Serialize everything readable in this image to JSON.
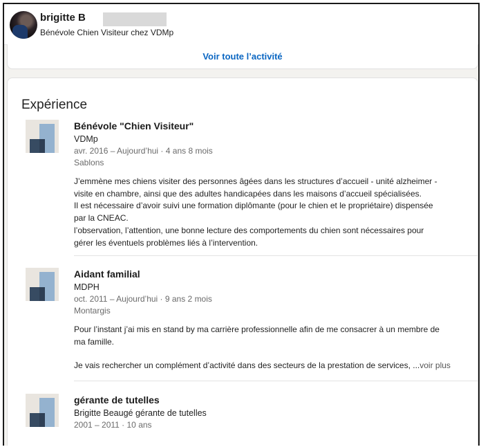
{
  "profile": {
    "name": "brigitte B",
    "headline": "Bénévole Chien Visiteur chez VDMp"
  },
  "activity": {
    "link_label": "Voir toute l’activité"
  },
  "experience": {
    "title": "Expérience",
    "items": [
      {
        "role": "Bénévole \"Chien Visiteur\"",
        "company": "VDMp",
        "dates": "avr. 2016 – Aujourd’hui · 4 ans 8 mois",
        "location": "Sablons",
        "description": [
          "J’emmène mes chiens visiter des personnes âgées dans les structures d’accueil - unité alzheimer -",
          "visite en chambre, ainsi que des adultes handicapées dans les maisons d’accueil spécialisées.",
          "Il est nécessaire d’avoir suivi une formation diplômante (pour le chien et le propriétaire) dispensée",
          "par la CNEAC.",
          "l’observation, l’attention, une bonne lecture des comportements du chien sont nécessaires pour",
          "gérer les éventuels problèmes liés à l’intervention."
        ]
      },
      {
        "role": "Aidant familial",
        "company": "MDPH",
        "dates": "oct. 2011 – Aujourd’hui · 9 ans 2 mois",
        "location": "Montargis",
        "description": [
          "Pour l’instant j’ai mis en stand by ma carrière professionnelle afin de me consacrer à un membre de",
          "ma famille.",
          "Je vais rechercher un complément d’activité dans des secteurs de la prestation de services, ..."
        ],
        "more_label": "voir plus"
      },
      {
        "role": "gérante de tutelles",
        "company": "Brigitte Beaugé gérante de tutelles",
        "dates": "2001 – 2011 · 10 ans"
      }
    ]
  }
}
